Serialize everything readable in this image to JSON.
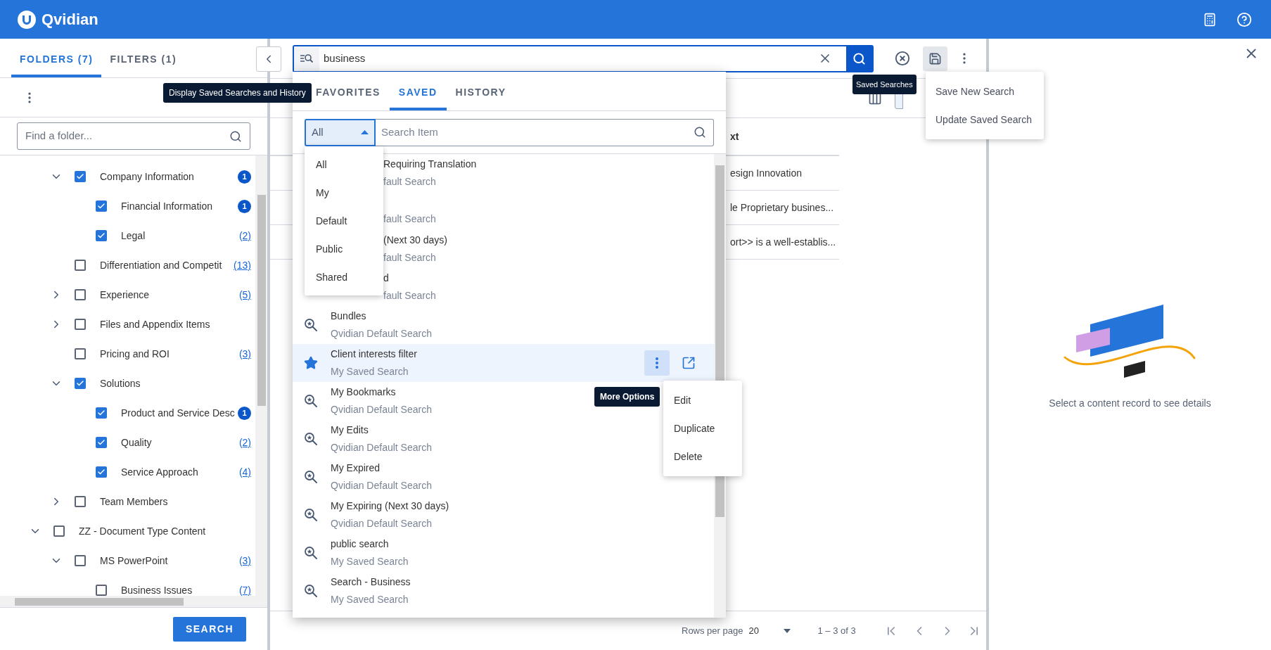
{
  "app": {
    "title": "Qvidian"
  },
  "folders_panel": {
    "tabs": [
      {
        "label": "FOLDERS (7)",
        "selected": true
      },
      {
        "label": "FILTERS (1)",
        "selected": false
      }
    ],
    "search": {
      "placeholder": "Find a folder..."
    },
    "tree": [
      {
        "children": [
          {
            "label": "Company Information",
            "checked": true,
            "expanded": true,
            "badge": "1",
            "children": [
              {
                "label": "Financial Information",
                "checked": true,
                "badge": "1"
              },
              {
                "label": "Legal",
                "checked": true,
                "count": "(2)"
              }
            ]
          },
          {
            "label": "Differentiation and Competit",
            "checked": false,
            "count": "(13)"
          },
          {
            "label": "Experience",
            "checked": false,
            "expanded": false,
            "count": "(5)"
          },
          {
            "label": "Files and Appendix Items",
            "checked": false,
            "expanded": false
          },
          {
            "label": "Pricing and ROI",
            "checked": false,
            "count": "(3)"
          },
          {
            "label": "Solutions",
            "checked": true,
            "expanded": true,
            "children": [
              {
                "label": "Product and Service Desc",
                "checked": true,
                "badge": "1"
              },
              {
                "label": "Quality",
                "checked": true,
                "count": "(2)"
              },
              {
                "label": "Service Approach",
                "checked": true,
                "count": "(4)"
              }
            ]
          },
          {
            "label": "Team Members",
            "checked": false,
            "expanded": false
          }
        ]
      },
      {
        "label": "ZZ - Document Type Content",
        "checked": false,
        "expanded": true,
        "children": [
          {
            "label": "MS PowerPoint",
            "checked": false,
            "expanded": true,
            "count": "(3)",
            "children": [
              {
                "label": "Business Issues",
                "checked": false,
                "count": "(7)"
              }
            ]
          }
        ]
      }
    ],
    "search_button": "SEARCH"
  },
  "history_tooltip": "Display Saved Searches and History",
  "search_bar": {
    "value": "business"
  },
  "saved_popup": {
    "tabs": [
      {
        "label": "FAVORITES",
        "selected": false
      },
      {
        "label": "SAVED",
        "selected": true
      },
      {
        "label": "HISTORY",
        "selected": false
      }
    ],
    "scope_select": {
      "value": "All",
      "expanded": true
    },
    "scope_options": [
      "All",
      "My",
      "Default",
      "Public",
      "Shared"
    ],
    "search": {
      "placeholder": "Search Item"
    },
    "items": [
      {
        "kind": "covered",
        "title": "Requiring Translation",
        "subtitle": "fault Search",
        "selected": false
      },
      {
        "kind": "covered",
        "subtitle": "fault Search",
        "selected": false
      },
      {
        "kind": "covered",
        "title": "(Next 30 days)",
        "subtitle": "fault Search",
        "selected": false
      },
      {
        "kind": "covered",
        "title": "d",
        "subtitle": "fault Search",
        "selected": false
      },
      {
        "kind": "default",
        "title": "Bundles",
        "subtitle": "Qvidian Default Search",
        "selected": false
      },
      {
        "kind": "favorite",
        "title": "Client interests filter",
        "subtitle": "My Saved Search",
        "selected": true
      },
      {
        "kind": "default",
        "title": "My Bookmarks",
        "subtitle": "Qvidian Default Search",
        "selected": false
      },
      {
        "kind": "default",
        "title": "My Edits",
        "subtitle": "Qvidian Default Search",
        "selected": false
      },
      {
        "kind": "default",
        "title": "My Expired",
        "subtitle": "Qvidian Default Search",
        "selected": false
      },
      {
        "kind": "default",
        "title": "My Expiring (Next 30 days)",
        "subtitle": "Qvidian Default Search",
        "selected": false
      },
      {
        "kind": "default",
        "title": "public search",
        "subtitle": "My Saved Search",
        "selected": false
      },
      {
        "kind": "default",
        "title": "Search - Business",
        "subtitle": "My Saved Search",
        "selected": false
      }
    ]
  },
  "more_options_tooltip": "More Options",
  "item_menu": [
    "Edit",
    "Duplicate",
    "Delete"
  ],
  "saved_searches_tooltip": "Saved Searches",
  "saved_menu": [
    "Save New Search",
    "Update Saved Search"
  ],
  "results": {
    "header": "xt",
    "rows": [
      "esign Innovation",
      "le Proprietary busines...",
      "ort>> is a well-establis..."
    ],
    "pagination": {
      "rows_per_page_label": "Rows per page",
      "rows_per_page": "20",
      "range": "1 – 3 of 3"
    }
  },
  "details": {
    "empty_message": "Select a content record to see details"
  }
}
